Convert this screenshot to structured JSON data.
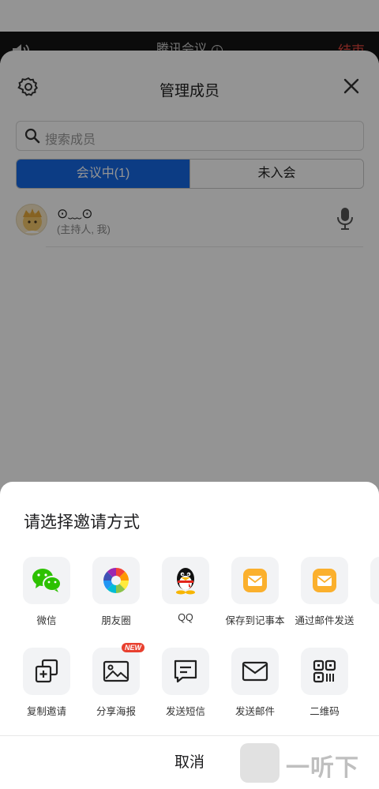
{
  "meeting_bar": {
    "title": "腾讯会议",
    "info_symbol": "i",
    "end_label": "结束"
  },
  "panel": {
    "title": "管理成员",
    "search_placeholder": "搜索成员",
    "tabs": [
      {
        "label": "会议中(1)",
        "active": true
      },
      {
        "label": "未入会",
        "active": false
      }
    ],
    "member": {
      "name": "⊙﹏⊙",
      "role": "(主持人, 我)"
    }
  },
  "sheet": {
    "title": "请选择邀请方式",
    "row1": [
      {
        "label": "微信",
        "icon": "wechat-icon"
      },
      {
        "label": "朋友圈",
        "icon": "moments-icon"
      },
      {
        "label": "QQ",
        "icon": "qq-icon"
      },
      {
        "label": "保存到记事本",
        "icon": "notepad-icon"
      },
      {
        "label": "通过邮件发送",
        "icon": "mail-app-icon"
      }
    ],
    "row2": [
      {
        "label": "复制邀请",
        "icon": "copy-icon"
      },
      {
        "label": "分享海报",
        "icon": "poster-icon",
        "badge": "NEW"
      },
      {
        "label": "发送短信",
        "icon": "sms-icon"
      },
      {
        "label": "发送邮件",
        "icon": "email-icon"
      },
      {
        "label": "二维码",
        "icon": "qrcode-icon"
      }
    ],
    "cancel_label": "取消"
  },
  "watermark": {
    "text": "一听下载"
  },
  "colors": {
    "accent": "#1668e3",
    "end_red": "#e0463d",
    "wechat_green": "#2dc100",
    "mail_orange": "#fbb02d"
  }
}
